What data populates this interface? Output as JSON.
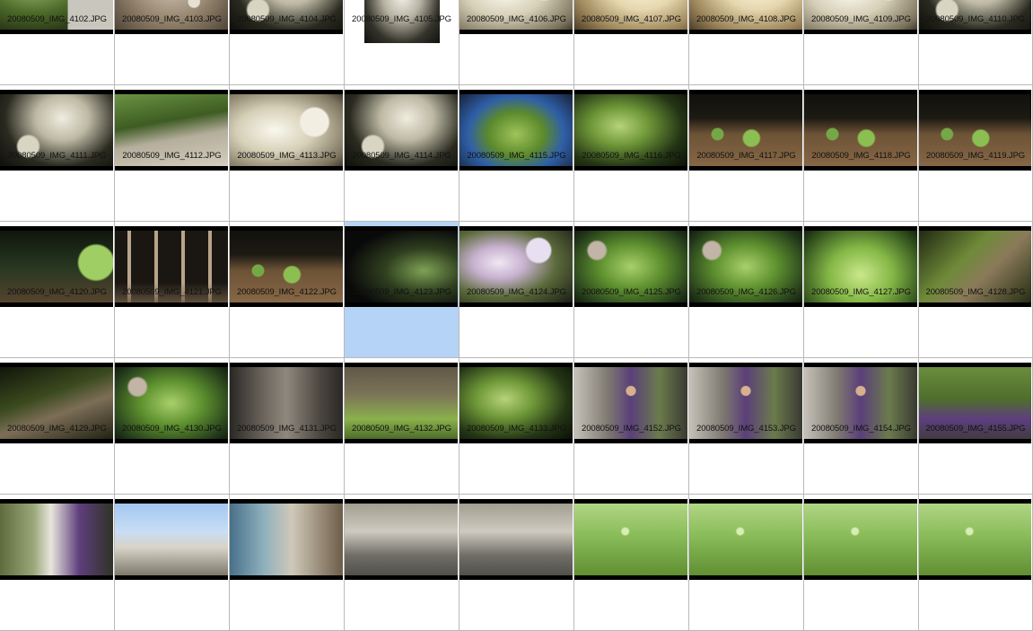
{
  "browser": {
    "selected_file": "20080509_IMG_4123.JPG",
    "items": [
      {
        "label": "20080509_IMG_4102.JPG",
        "tone": "grass"
      },
      {
        "label": "20080509_IMG_4103.JPG",
        "tone": "gravel"
      },
      {
        "label": "20080509_IMG_4104.JPG",
        "tone": "succulent-dark"
      },
      {
        "label": "20080509_IMG_4105.JPG",
        "tone": "succulent-portrait"
      },
      {
        "label": "20080509_IMG_4106.JPG",
        "tone": "succulent-bright"
      },
      {
        "label": "20080509_IMG_4107.JPG",
        "tone": "blur-cream"
      },
      {
        "label": "20080509_IMG_4108.JPG",
        "tone": "blur-cream"
      },
      {
        "label": "20080509_IMG_4109.JPG",
        "tone": "succulent-bright"
      },
      {
        "label": "20080509_IMG_4110.JPG",
        "tone": "succulent-dark"
      },
      {
        "label": "20080509_IMG_4111.JPG",
        "tone": "succulent-dark"
      },
      {
        "label": "20080509_IMG_4112.JPG",
        "tone": "blue-pot"
      },
      {
        "label": "20080509_IMG_4113.JPG",
        "tone": "succulent-bright"
      },
      {
        "label": "20080509_IMG_4114.JPG",
        "tone": "succulent-dark"
      },
      {
        "label": "20080509_IMG_4115.JPG",
        "tone": "blue-pot-green"
      },
      {
        "label": "20080509_IMG_4116.JPG",
        "tone": "leafy-dark"
      },
      {
        "label": "20080509_IMG_4117.JPG",
        "tone": "soil-sprouts"
      },
      {
        "label": "20080509_IMG_4118.JPG",
        "tone": "soil-sprouts"
      },
      {
        "label": "20080509_IMG_4119.JPG",
        "tone": "soil-sprouts"
      },
      {
        "label": "20080509_IMG_4120.JPG",
        "tone": "garden-night"
      },
      {
        "label": "20080509_IMG_4121.JPG",
        "tone": "bamboo"
      },
      {
        "label": "20080509_IMG_4122.JPG",
        "tone": "soil-sprouts"
      },
      {
        "label": "20080509_IMG_4123.JPG",
        "tone": "flowers-night"
      },
      {
        "label": "20080509_IMG_4124.JPG",
        "tone": "flowers-blur"
      },
      {
        "label": "20080509_IMG_4125.JPG",
        "tone": "leafy-green"
      },
      {
        "label": "20080509_IMG_4126.JPG",
        "tone": "leafy-green"
      },
      {
        "label": "20080509_IMG_4127.JPG",
        "tone": "leafy-bright"
      },
      {
        "label": "20080509_IMG_4128.JPG",
        "tone": "branches"
      },
      {
        "label": "20080509_IMG_4129.JPG",
        "tone": "branches-dark"
      },
      {
        "label": "20080509_IMG_4130.JPG",
        "tone": "leafy-green"
      },
      {
        "label": "20080509_IMG_4131.JPG",
        "tone": "wall-grey"
      },
      {
        "label": "20080509_IMG_4132.JPG",
        "tone": "agave"
      },
      {
        "label": "20080509_IMG_4133.JPG",
        "tone": "leafy-dark"
      },
      {
        "label": "20080509_IMG_4152.JPG",
        "tone": "people"
      },
      {
        "label": "20080509_IMG_4153.JPG",
        "tone": "people"
      },
      {
        "label": "20080509_IMG_4154.JPG",
        "tone": "people"
      },
      {
        "label": "20080509_IMG_4155.JPG",
        "tone": "people-green"
      },
      {
        "label": "",
        "tone": "people-day"
      },
      {
        "label": "",
        "tone": "sky-house"
      },
      {
        "label": "",
        "tone": "house-day"
      },
      {
        "label": "",
        "tone": "street"
      },
      {
        "label": "",
        "tone": "street"
      },
      {
        "label": "",
        "tone": "grass-day"
      },
      {
        "label": "",
        "tone": "grass-day"
      },
      {
        "label": "",
        "tone": "grass-day"
      },
      {
        "label": "",
        "tone": "grass-day"
      }
    ]
  }
}
